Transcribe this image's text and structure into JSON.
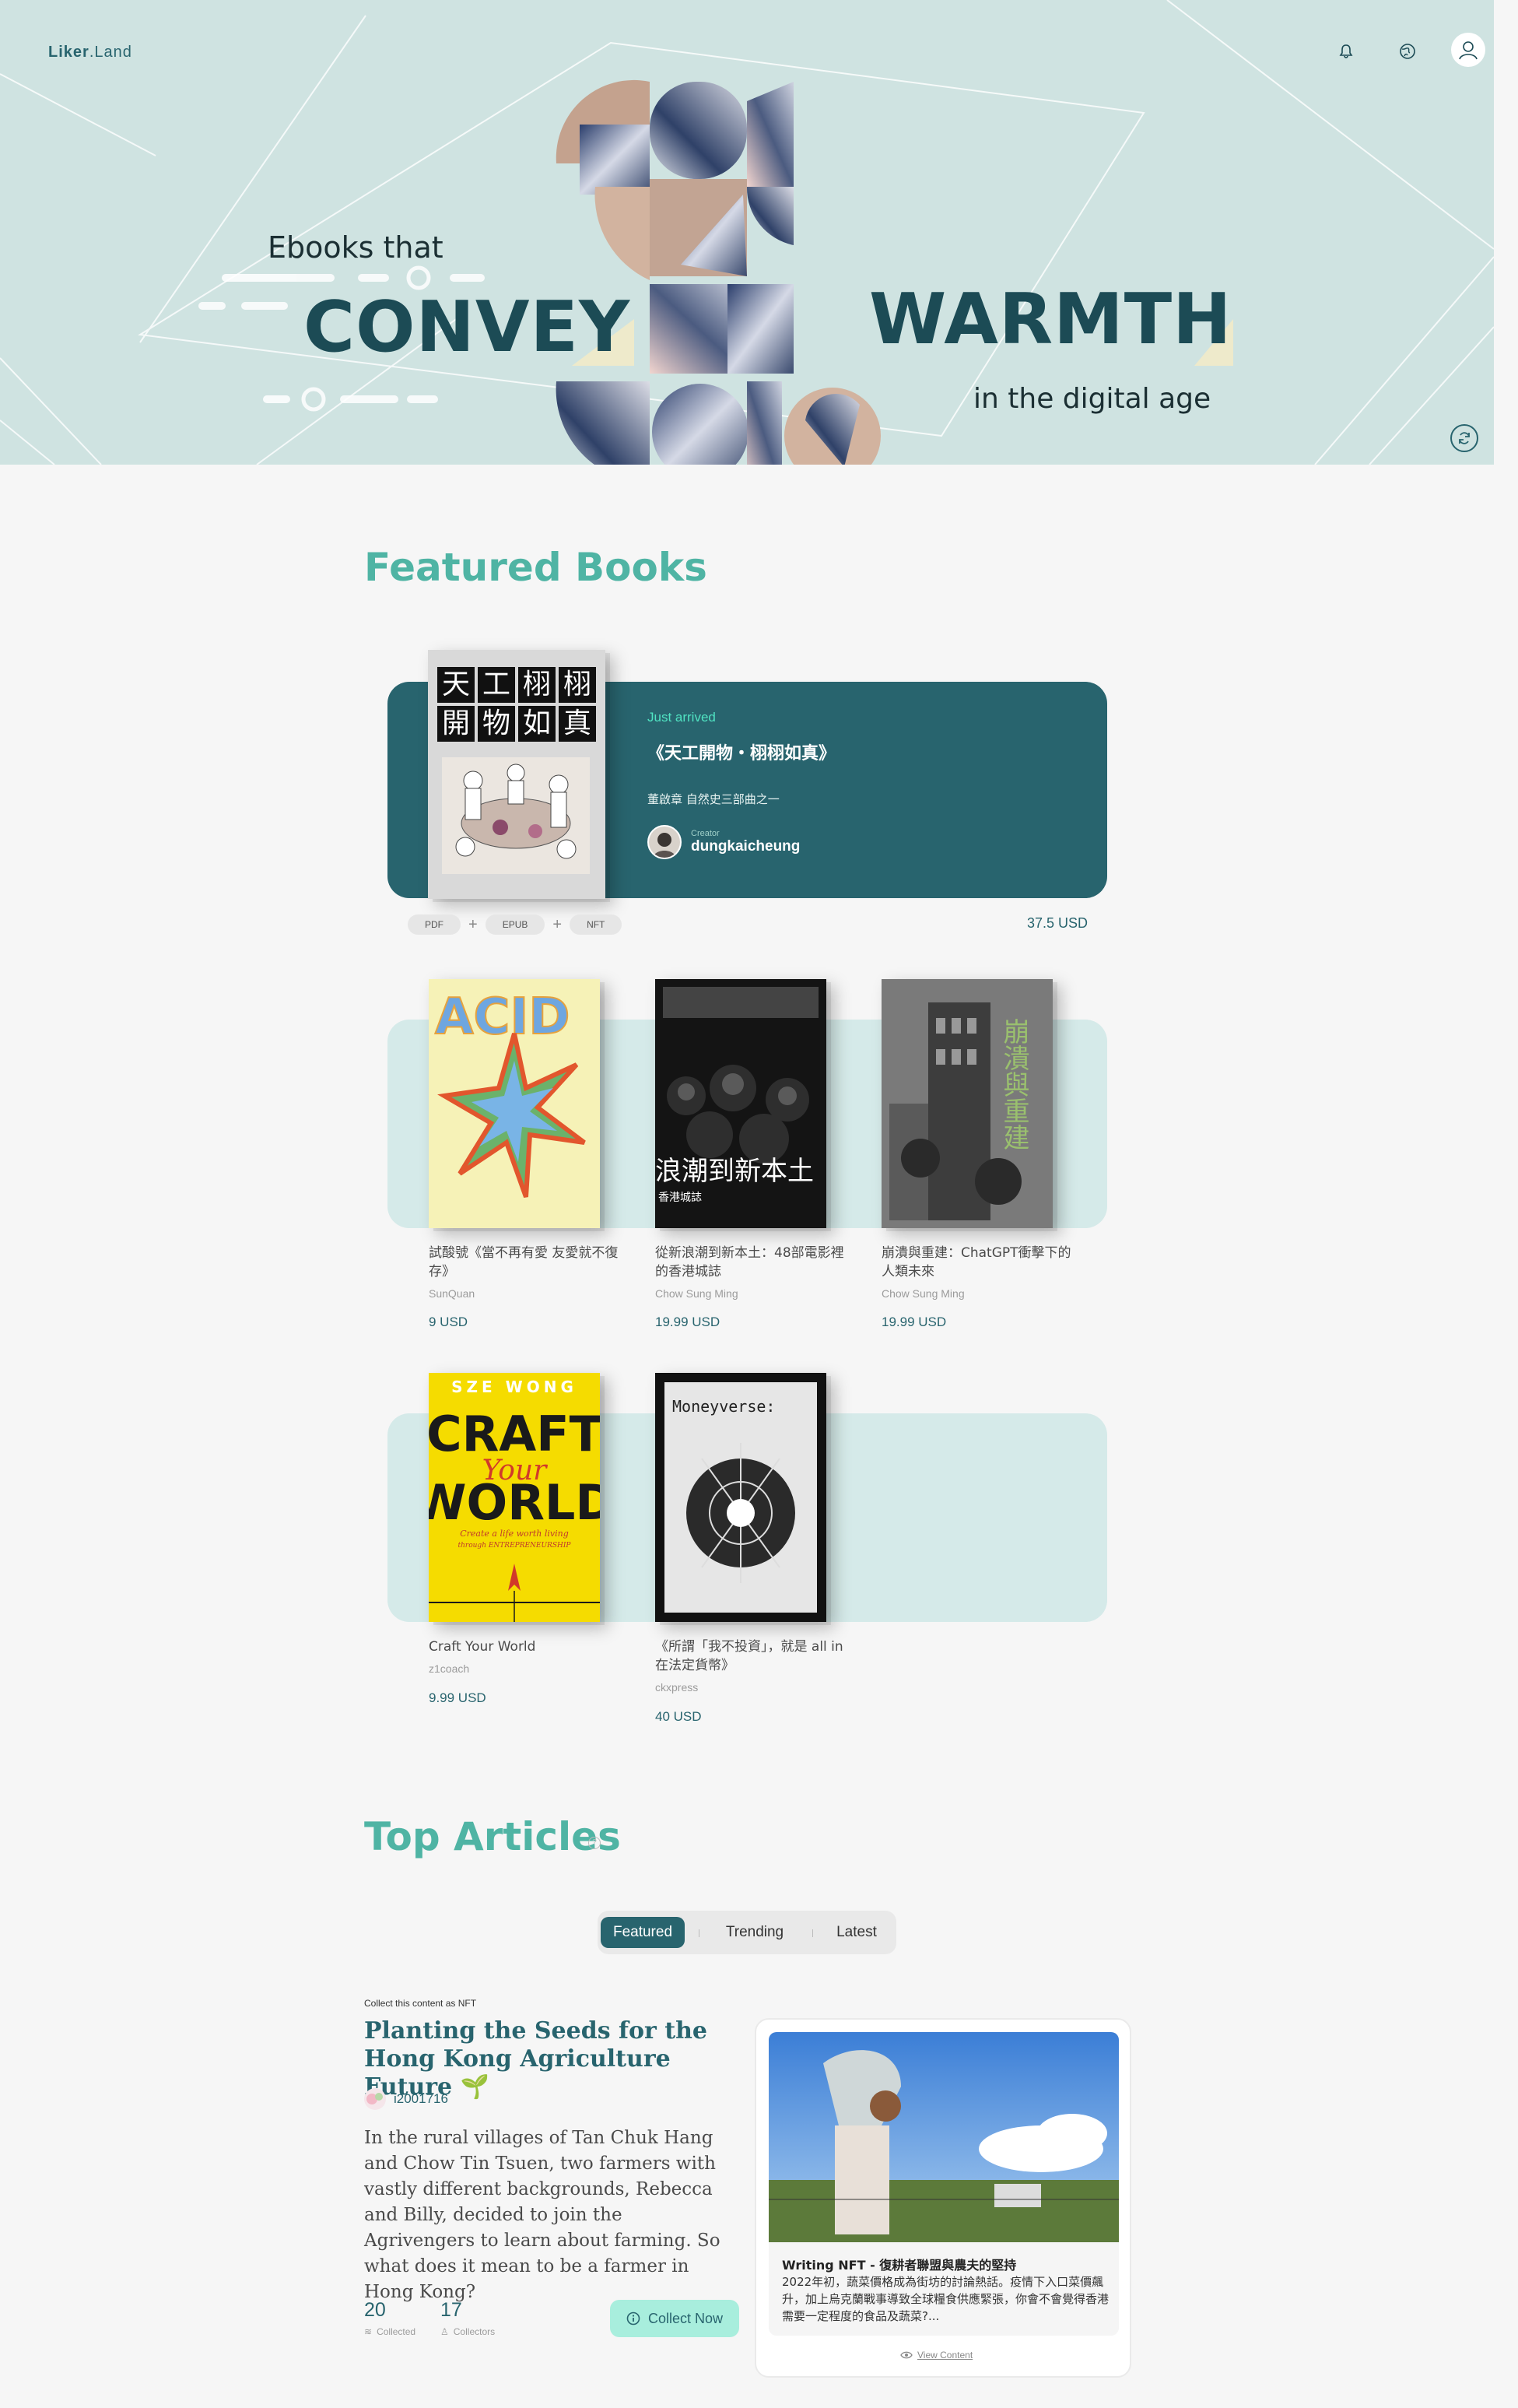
{
  "brand": {
    "logo_main": "Liker",
    "logo_sub": ".Land"
  },
  "hero": {
    "line1": "Ebooks that",
    "word1": "CONVEY",
    "word2": "WARMTH",
    "line2": "in the digital age"
  },
  "header_icons": [
    "bell-icon",
    "globe-icon",
    "user-avatar"
  ],
  "featured": {
    "title": "Featured Books",
    "main": {
      "tag": "Just arrived",
      "title": "《天工開物・栩栩如真》",
      "subtitle": "董啟章 自然史三部曲之一",
      "creator_label": "Creator",
      "creator": "dungkaicheung",
      "formats": [
        "PDF",
        "EPUB",
        "NFT"
      ],
      "price": "37.5 USD",
      "cover_text": [
        "天",
        "工",
        "栩",
        "栩",
        "開",
        "物",
        "如",
        "真"
      ]
    },
    "books": [
      {
        "title": "試酸號《當不再有愛 友愛就不復存》",
        "author": "SunQuan",
        "price": "9 USD"
      },
      {
        "title": "從新浪潮到新本土：48部電影裡的香港城誌",
        "author": "Chow Sung Ming",
        "price": "19.99 USD"
      },
      {
        "title": "崩潰與重建：ChatGPT衝擊下的人類未來",
        "author": "Chow Sung Ming",
        "price": "19.99 USD"
      },
      {
        "title": "Craft Your World",
        "author": "z1coach",
        "price": "9.99 USD"
      },
      {
        "title": "《所謂「我不投資」，就是 all in 在法定貨幣》",
        "author": "ckxpress",
        "price": "40 USD"
      }
    ],
    "covers": {
      "acid_top": "ACID",
      "wave_main": "浪潮到新本土",
      "wave_sub": "香港城誌",
      "collapse_main": "崩潰與重建",
      "craft_author": "SZE WONG",
      "craft_l1": "CRAFT",
      "craft_l2": "Your",
      "craft_l3": "WORLD",
      "craft_sub1": "Create a life worth living",
      "craft_sub2": "through ENTREPRENEURSHIP",
      "money_top": "Moneyverse:"
    }
  },
  "articles": {
    "title": "Top Articles",
    "tabs": [
      "Featured",
      "Trending",
      "Latest"
    ],
    "active_tab": "Featured",
    "item": {
      "nft_label": "Collect this content as NFT",
      "title": "Planting the Seeds for the Hong Kong Agriculture Future 🌱",
      "author": "i2001716",
      "body": "In the rural villages of Tan Chuk Hang and Chow Tin Tsuen, two farmers with vastly different backgrounds, Rebecca and Billy, decided to join the Agrivengers to learn about farming. So what does it mean to be a farmer in Hong Kong?",
      "collected_count": "20",
      "collected_label": "Collected",
      "collectors_count": "17",
      "collectors_label": "Collectors",
      "collect_btn": "Collect Now",
      "nft_card_title": "Writing NFT - 復耕者聯盟與農夫的堅持",
      "nft_card_desc": "2022年初，蔬菜價格成為街坊的討論熱話。疫情下入口菜價飆升，加上烏克蘭戰事導致全球糧食供應緊張，你會不會覺得香港需要一定程度的食品及蔬菜?...",
      "view_content": "View Content"
    }
  },
  "colors": {
    "hero_bg": "#cfe3e1",
    "brand_dark": "#28646e",
    "accent_green": "#50e3c2",
    "title_teal": "#4fb4a4",
    "shelf_bg": "#d5eae9"
  }
}
